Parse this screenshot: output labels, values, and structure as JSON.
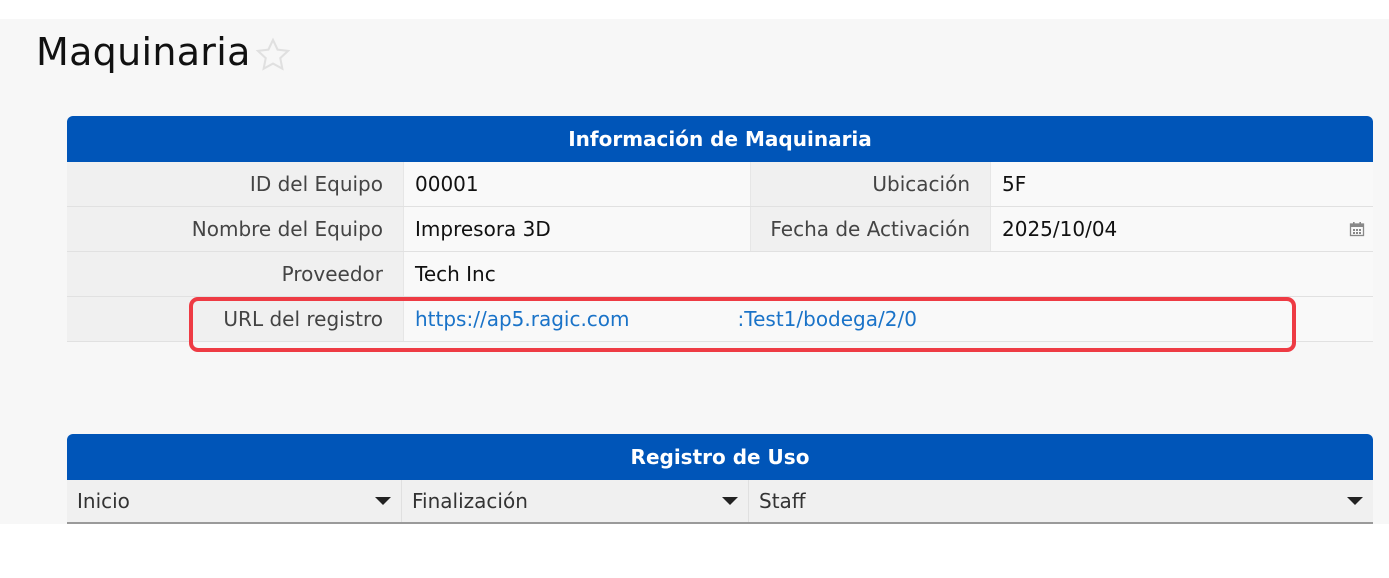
{
  "page": {
    "title": "Maquinaria"
  },
  "info_section": {
    "title": "Información de Maquinaria",
    "fields": {
      "equipment_id": {
        "label": "ID del Equipo",
        "value": "00001"
      },
      "location": {
        "label": "Ubicación",
        "value": "5F"
      },
      "equipment_name": {
        "label": "Nombre del Equipo",
        "value": "Impresora 3D"
      },
      "activation_date": {
        "label": "Fecha de Activación",
        "value": "2025/10/04"
      },
      "supplier": {
        "label": "Proveedor",
        "value": "Tech Inc"
      },
      "record_url": {
        "label": "URL del registro",
        "value_start": "https://ap5.ragic.com",
        "value_end": ":Test1/bodega/2/0"
      }
    }
  },
  "usage_section": {
    "title": "Registro de Uso",
    "columns": [
      "Inicio",
      "Finalización",
      "Staff"
    ]
  },
  "colors": {
    "header_blue": "#0055b8",
    "highlight_red": "#ee3b44",
    "link_blue": "#1a73c8"
  },
  "icons": {
    "favorite": "star-icon",
    "date_picker": "calendar-icon",
    "column_menu": "caret-down-icon"
  }
}
